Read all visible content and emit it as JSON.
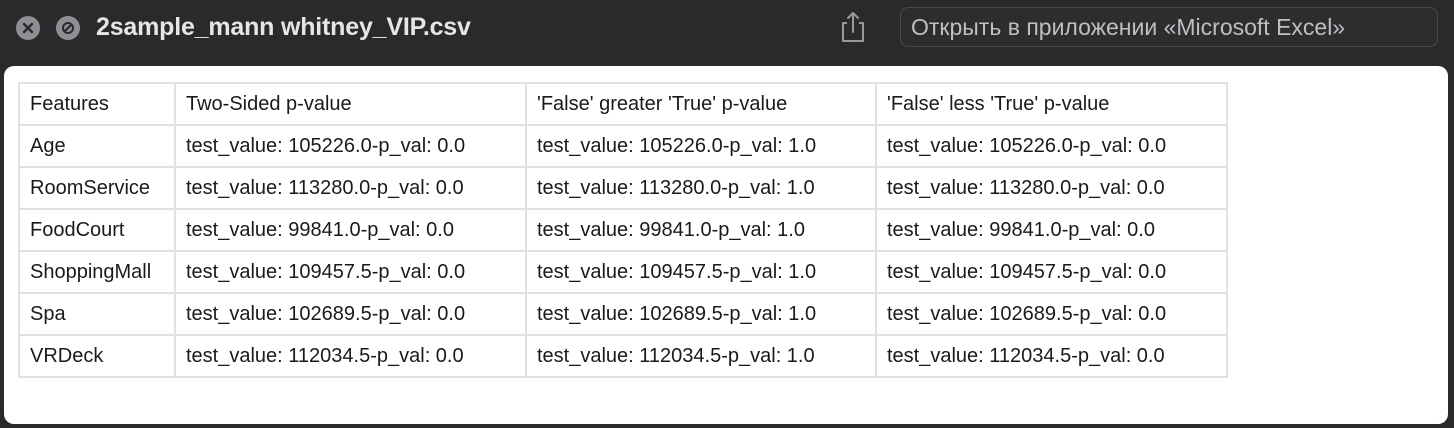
{
  "window": {
    "filename": "2sample_mann whitney_VIP.csv",
    "open_in_label": "Открыть в приложении «Microsoft Excel»"
  },
  "table": {
    "headers": [
      "Features",
      "Two-Sided p-value",
      "'False' greater 'True' p-value",
      "'False' less 'True' p-value"
    ],
    "rows": [
      [
        "Age",
        "test_value: 105226.0-p_val: 0.0",
        "test_value: 105226.0-p_val: 1.0",
        "test_value: 105226.0-p_val: 0.0"
      ],
      [
        "RoomService",
        "test_value: 113280.0-p_val: 0.0",
        "test_value: 113280.0-p_val: 1.0",
        "test_value: 113280.0-p_val: 0.0"
      ],
      [
        "FoodCourt",
        "test_value: 99841.0-p_val: 0.0",
        "test_value: 99841.0-p_val: 1.0",
        "test_value: 99841.0-p_val: 0.0"
      ],
      [
        "ShoppingMall",
        "test_value: 109457.5-p_val: 0.0",
        "test_value: 109457.5-p_val: 1.0",
        "test_value: 109457.5-p_val: 0.0"
      ],
      [
        "Spa",
        "test_value: 102689.5-p_val: 0.0",
        "test_value: 102689.5-p_val: 1.0",
        "test_value: 102689.5-p_val: 0.0"
      ],
      [
        "VRDeck",
        "test_value: 112034.5-p_val: 0.0",
        "test_value: 112034.5-p_val: 1.0",
        "test_value: 112034.5-p_val: 0.0"
      ]
    ]
  },
  "icons": {
    "close": "close-icon",
    "stop": "stop-icon",
    "share": "share-icon"
  },
  "colors": {
    "titlebar_bg": "#2a2a2d",
    "icon_gray": "#8e8e93",
    "content_bg": "#ffffff",
    "grid_line": "#e1e1e1"
  }
}
